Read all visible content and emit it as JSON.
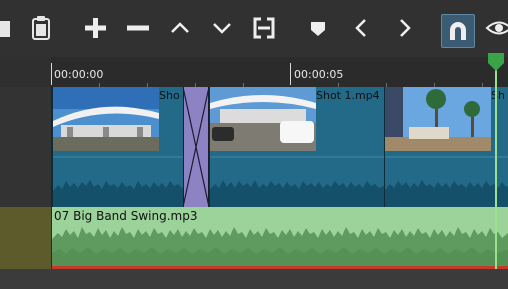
{
  "toolbar": {
    "buttons": [
      {
        "name": "clip-icon-partial",
        "glyph": "▮"
      },
      {
        "name": "paste-icon",
        "glyph": "📋"
      },
      {
        "name": "append-icon",
        "glyph": "+"
      },
      {
        "name": "remove-icon",
        "glyph": "−"
      },
      {
        "name": "lift-icon",
        "glyph": "∧"
      },
      {
        "name": "overwrite-icon",
        "glyph": "∨"
      },
      {
        "name": "split-icon",
        "glyph": "⟦⟧"
      },
      {
        "name": "marker-icon",
        "glyph": "⬟"
      },
      {
        "name": "previous-marker-icon",
        "glyph": "<"
      },
      {
        "name": "next-marker-icon",
        "glyph": ">"
      },
      {
        "name": "snap-icon",
        "glyph": "∩",
        "active": true
      },
      {
        "name": "scrub-icon",
        "glyph": "👁"
      }
    ]
  },
  "ruler": {
    "timecodes": [
      "00:00:00",
      "00:00:05"
    ]
  },
  "video_track": {
    "clips": [
      {
        "name": "Shot",
        "label": "Sho"
      },
      {
        "name": "Shot 1.mp4",
        "label": "Shot 1.mp4"
      },
      {
        "name": "Shot",
        "label": "Sh"
      }
    ]
  },
  "audio_track": {
    "clip_label": "07 Big Band Swing.mp3"
  },
  "colors": {
    "video_clip": "#226a88",
    "audio_clip": "#9cd39b",
    "transition": "#8d82c4",
    "playhead": "#9be08a",
    "active_button": "#3b5b72"
  }
}
